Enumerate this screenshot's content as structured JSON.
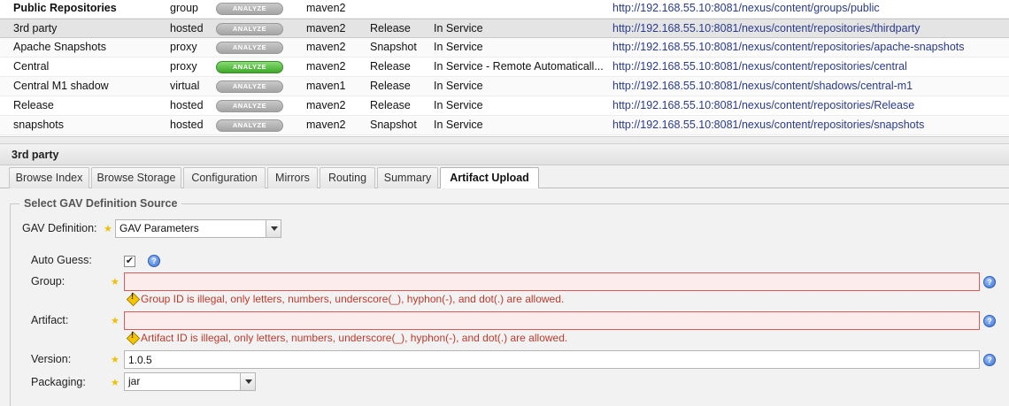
{
  "repositories": [
    {
      "name": "Public Repositories",
      "type": "group",
      "health": "ANALYZE",
      "health_active": false,
      "format": "maven2",
      "policy": "",
      "status": "",
      "url": "http://192.168.55.10:8081/nexus/content/groups/public"
    },
    {
      "name": "3rd party",
      "type": "hosted",
      "health": "ANALYZE",
      "health_active": false,
      "format": "maven2",
      "policy": "Release",
      "status": "In Service",
      "url": "http://192.168.55.10:8081/nexus/content/repositories/thirdparty"
    },
    {
      "name": "Apache Snapshots",
      "type": "proxy",
      "health": "ANALYZE",
      "health_active": false,
      "format": "maven2",
      "policy": "Snapshot",
      "status": "In Service",
      "url": "http://192.168.55.10:8081/nexus/content/repositories/apache-snapshots"
    },
    {
      "name": "Central",
      "type": "proxy",
      "health": "ANALYZE",
      "health_active": true,
      "format": "maven2",
      "policy": "Release",
      "status": "In Service - Remote Automaticall...",
      "url": "http://192.168.55.10:8081/nexus/content/repositories/central"
    },
    {
      "name": "Central M1 shadow",
      "type": "virtual",
      "health": "ANALYZE",
      "health_active": false,
      "format": "maven1",
      "policy": "Release",
      "status": "In Service",
      "url": "http://192.168.55.10:8081/nexus/content/shadows/central-m1"
    },
    {
      "name": "Release",
      "type": "hosted",
      "health": "ANALYZE",
      "health_active": false,
      "format": "maven2",
      "policy": "Release",
      "status": "In Service",
      "url": "http://192.168.55.10:8081/nexus/content/repositories/Release"
    },
    {
      "name": "snapshots",
      "type": "hosted",
      "health": "ANALYZE",
      "health_active": false,
      "format": "maven2",
      "policy": "Snapshot",
      "status": "In Service",
      "url": "http://192.168.55.10:8081/nexus/content/repositories/snapshots"
    }
  ],
  "panel": {
    "title": "3rd party",
    "tabs": [
      "Browse Index",
      "Browse Storage",
      "Configuration",
      "Mirrors",
      "Routing",
      "Summary",
      "Artifact Upload"
    ],
    "active_tab": "Artifact Upload"
  },
  "form": {
    "legend": "Select GAV Definition Source",
    "gav_definition_label": "GAV Definition:",
    "gav_definition_value": "GAV Parameters",
    "auto_guess_label": "Auto Guess:",
    "auto_guess_checked": true,
    "group_label": "Group:",
    "group_value": "",
    "group_error": "Group ID is illegal, only letters, numbers, underscore(_), hyphon(-), and dot(.) are allowed.",
    "artifact_label": "Artifact:",
    "artifact_value": "",
    "artifact_error": "Artifact ID is illegal, only letters, numbers, underscore(_), hyphon(-), and dot(.) are allowed.",
    "version_label": "Version:",
    "version_value": "1.0.5",
    "packaging_label": "Packaging:",
    "packaging_value": "jar",
    "help_glyph": "?",
    "required_glyph": "★",
    "checkmark_glyph": "✔"
  },
  "colors": {
    "link": "#2a3b8c",
    "error": "#c0392b",
    "health_active": "#3fa82a"
  }
}
